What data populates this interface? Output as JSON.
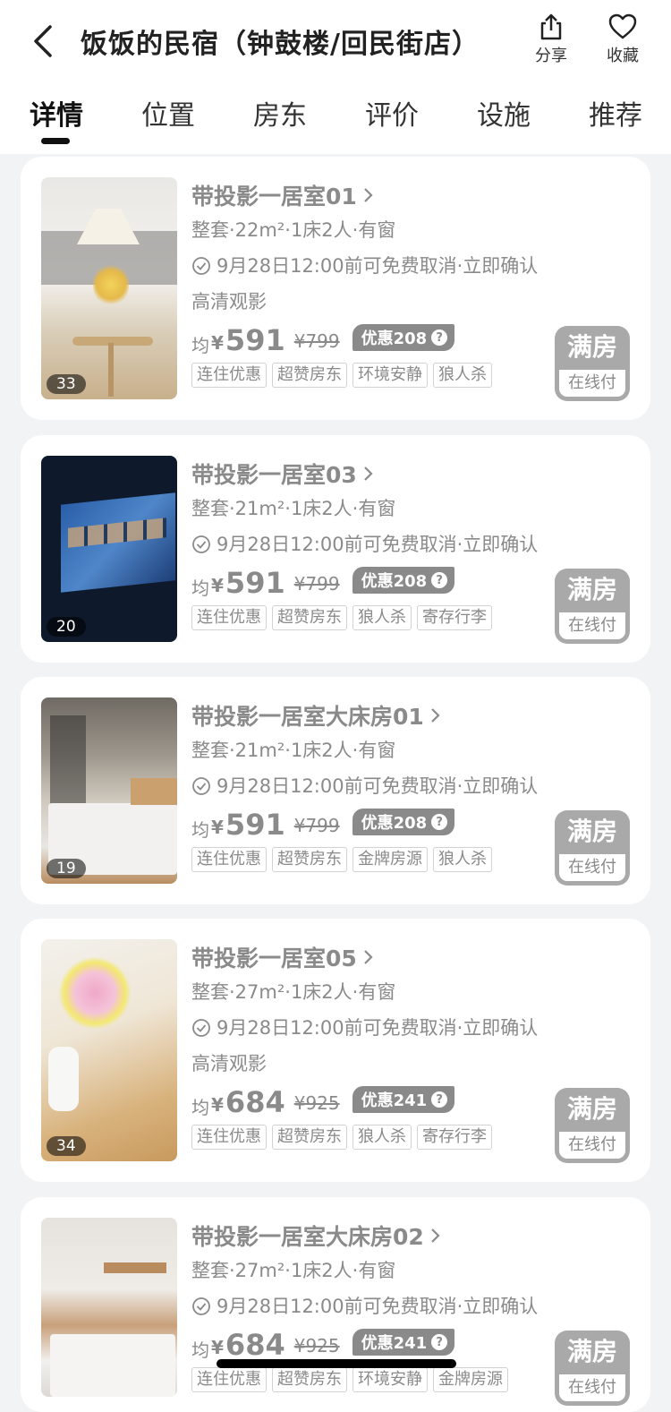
{
  "header": {
    "title": "饭饭的民宿（钟鼓楼/回民街店）",
    "share_label": "分享",
    "fav_label": "收藏"
  },
  "tabs": [
    "详情",
    "位置",
    "房东",
    "评价",
    "设施",
    "推荐"
  ],
  "rooms": [
    {
      "name": "带投影一居室01",
      "spec": "整套·22m²·1床2人·有窗",
      "cancel": "9月28日12:00前可免费取消·立即确认",
      "feature": "高清观影",
      "avg_label": "均",
      "currency": "¥",
      "price": "591",
      "orig_price": "¥799",
      "discount": "优惠208",
      "tags": [
        "连住优惠",
        "超赞房东",
        "环境安静",
        "狼人杀"
      ],
      "photo_count": "33",
      "status": "满房",
      "pay": "在线付"
    },
    {
      "name": "带投影一居室03",
      "spec": "整套·21m²·1床2人·有窗",
      "cancel": "9月28日12:00前可免费取消·立即确认",
      "feature": "",
      "avg_label": "均",
      "currency": "¥",
      "price": "591",
      "orig_price": "¥799",
      "discount": "优惠208",
      "tags": [
        "连住优惠",
        "超赞房东",
        "狼人杀",
        "寄存行李"
      ],
      "photo_count": "20",
      "status": "满房",
      "pay": "在线付"
    },
    {
      "name": "带投影一居室大床房01",
      "spec": "整套·21m²·1床2人·有窗",
      "cancel": "9月28日12:00前可免费取消·立即确认",
      "feature": "",
      "avg_label": "均",
      "currency": "¥",
      "price": "591",
      "orig_price": "¥799",
      "discount": "优惠208",
      "tags": [
        "连住优惠",
        "超赞房东",
        "金牌房源",
        "狼人杀"
      ],
      "photo_count": "19",
      "status": "满房",
      "pay": "在线付"
    },
    {
      "name": "带投影一居室05",
      "spec": "整套·27m²·1床2人·有窗",
      "cancel": "9月28日12:00前可免费取消·立即确认",
      "feature": "高清观影",
      "avg_label": "均",
      "currency": "¥",
      "price": "684",
      "orig_price": "¥925",
      "discount": "优惠241",
      "tags": [
        "连住优惠",
        "超赞房东",
        "狼人杀",
        "寄存行李"
      ],
      "photo_count": "34",
      "status": "满房",
      "pay": "在线付"
    },
    {
      "name": "带投影一居室大床房02",
      "spec": "整套·27m²·1床2人·有窗",
      "cancel": "9月28日12:00前可免费取消·立即确认",
      "feature": "",
      "avg_label": "均",
      "currency": "¥",
      "price": "684",
      "orig_price": "¥925",
      "discount": "优惠241",
      "tags": [
        "连住优惠",
        "超赞房东",
        "环境安静",
        "金牌房源"
      ],
      "photo_count": "",
      "status": "满房",
      "pay": "在线付"
    }
  ]
}
